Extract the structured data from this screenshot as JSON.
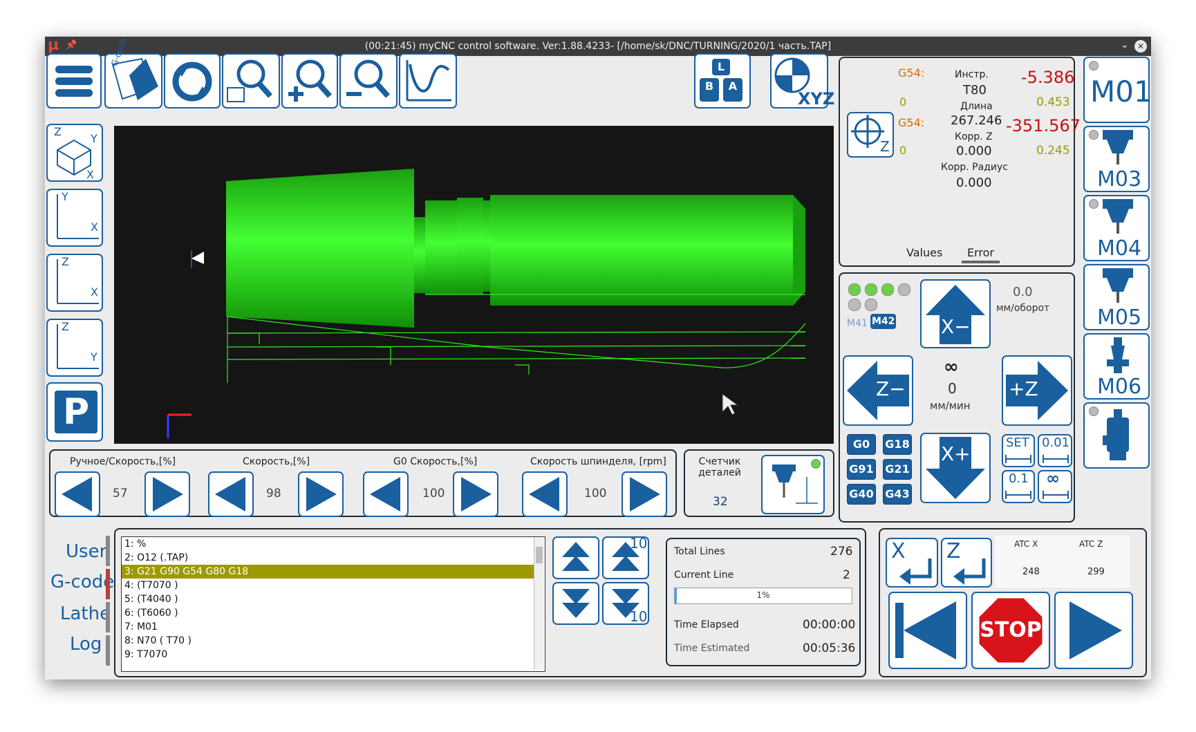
{
  "title": "(00:21:45) myCNC control software. Ver:1.88.4233- [/home/sk/DNC/TURNING/2020/1 часть.TAP]",
  "toolbar": {
    "gcode_label": "G-code",
    "xyz_label": "XYZ",
    "keys_l": "L",
    "keys_b": "B",
    "keys_a": "A"
  },
  "view_buttons": {
    "z": "Z",
    "y": "Y",
    "x": "X",
    "p": "P"
  },
  "info": {
    "g54_1": "G54:",
    "g54_1_val": "0",
    "g54_2": "G54:",
    "g54_2_val": "0",
    "tool_label": "Инстр.",
    "tool_value": "T80",
    "len_label": "Длина",
    "len_value": "267.246",
    "corrz_label": "Корр. Z",
    "corrz_value": "0.000",
    "corrr_label": "Корр. Радиус",
    "corrr_value": "0.000",
    "x_pos": "-5.386",
    "x_small": "0.453",
    "z_pos": "-351.567",
    "z_small": "0.245",
    "zero_z_label": "Z",
    "tab_values": "Values",
    "tab_error": "Error"
  },
  "mcodes": {
    "m01": "M01",
    "m03": "M03",
    "m04": "M04",
    "m05": "M05",
    "m06": "M06"
  },
  "jog": {
    "m41": "M41",
    "m42": "M42",
    "feed_rev": "0.0",
    "feed_rev_unit": "мм/оборот",
    "infinity": "∞",
    "feed_min": "0",
    "feed_min_unit": "мм/мин",
    "x_minus": "X−",
    "x_plus": "X+",
    "z_minus": "Z−",
    "z_plus": "+Z",
    "g0": "G0",
    "g18": "G18",
    "g91": "G91",
    "g21": "G21",
    "g40": "G40",
    "g43": "G43",
    "set": "SET",
    "step001": "0.01",
    "step01": "0.1",
    "step_inf": "∞"
  },
  "overrides": [
    {
      "label": "Ручное/Скорость,[%]",
      "value": "57"
    },
    {
      "label": "Скорость,[%]",
      "value": "98"
    },
    {
      "label": "G0 Скорость,[%]",
      "value": "100"
    },
    {
      "label": "Скорость шпинделя, [rpm]",
      "value": "100"
    }
  ],
  "counter": {
    "label": "Счетчик деталей",
    "value": "32"
  },
  "side_tabs": [
    "User",
    "G-code",
    "Lathe",
    "Log"
  ],
  "gcode_lines": [
    "1: %",
    "2: O12 (.TAP)",
    "3: G21 G90 G54 G80 G18",
    "4: (T7070 )",
    "5: (T4040 )",
    "6: (T6060 )",
    "7: M01",
    "8: N70 ( T70 )",
    "9: T7070"
  ],
  "scroll_buttons": {
    "ten_up": "10",
    "ten_down": "10"
  },
  "stats": {
    "total_lines_label": "Total Lines",
    "total_lines": "276",
    "current_line_label": "Current Line",
    "current_line": "2",
    "progress_text": "1%",
    "progress_value": 0.01,
    "time_elapsed_label": "Time Elapsed",
    "time_elapsed": "00:00:00",
    "time_estimated_label": "Time Estimated",
    "time_estimated": "00:05:36"
  },
  "atc": {
    "x_label": "ATC X",
    "x_value": "248",
    "z_label": "ATC Z",
    "z_value": "299",
    "home_x": "X",
    "home_z": "Z"
  },
  "stop_label": "STOP",
  "colors": {
    "accent": "#1a5f9e",
    "part": "#22dd11",
    "viewport": "#151515",
    "highlight": "#9c9a00",
    "stop": "#d8141b"
  }
}
